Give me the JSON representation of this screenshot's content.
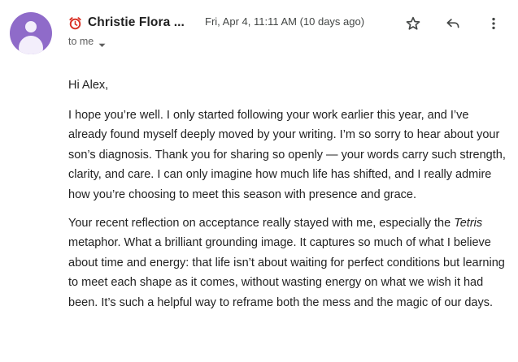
{
  "sender": {
    "name": "Christie Flora ...",
    "timestamp": "Fri, Apr 4, 11:11 AM (10 days ago)",
    "recipient": "to me",
    "avatar_color": "#8f6bc9"
  },
  "icons": {
    "label": "alarm-clock-icon",
    "star": "star-icon",
    "reply": "reply-icon",
    "more": "more-vertical-icon",
    "recipient_caret": "caret-down-icon"
  },
  "message": {
    "greeting": "Hi Alex,",
    "paragraph1": "I hope you’re well. I only started following your work earlier this year, and I’ve already found myself deeply moved by your writing. I’m so sorry to hear about your son’s diagnosis. Thank you for sharing so openly — your words carry such strength, clarity, and care. I can only imagine how much life has shifted, and I really admire how you’re choosing to meet this season with presence and grace.",
    "paragraph2_start": "Your recent reflection on acceptance really stayed with me, especially the ",
    "paragraph2_italic": "Tetris",
    "paragraph2_end": " metaphor. What a brilliant grounding image. It captures so much of what I believe about time and energy: that life isn’t about waiting for perfect conditions but learning to meet each shape as it comes, without wasting energy on what we wish it had been. It’s such a helpful way to reframe both the mess and the magic of our days."
  }
}
